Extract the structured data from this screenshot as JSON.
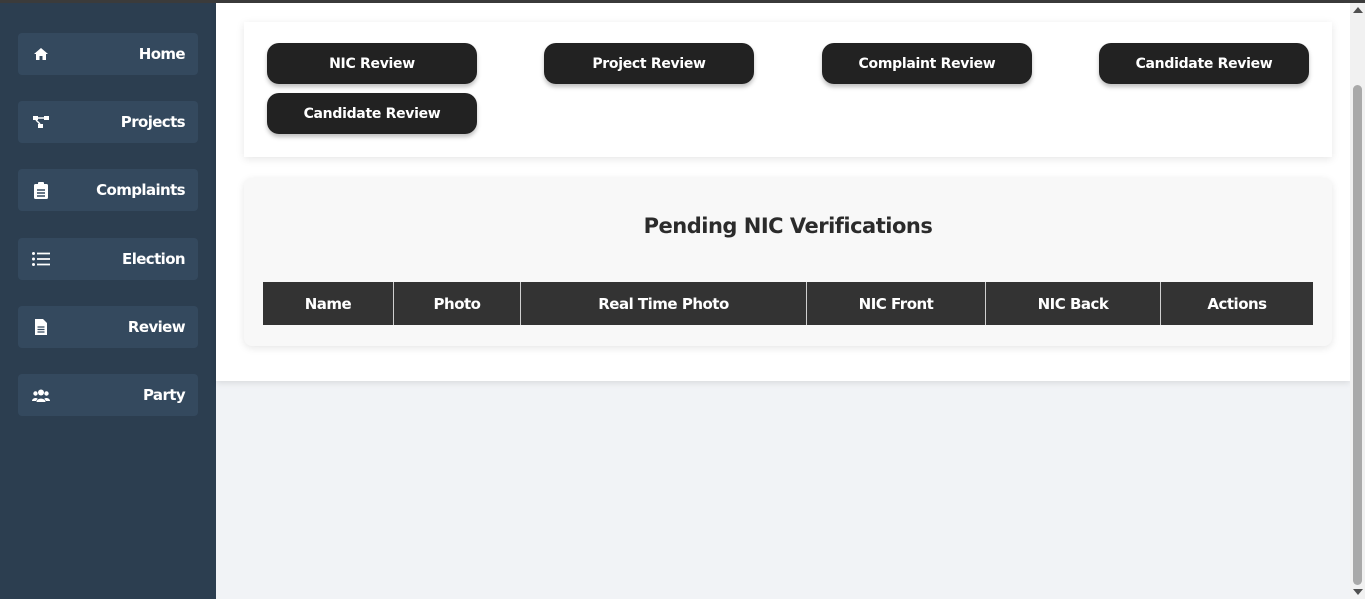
{
  "sidebar": {
    "items": [
      {
        "label": "Home",
        "icon": "home-icon"
      },
      {
        "label": "Projects",
        "icon": "sitemap-icon"
      },
      {
        "label": "Complaints",
        "icon": "clipboard-icon"
      },
      {
        "label": "Election",
        "icon": "list-icon"
      },
      {
        "label": "Review",
        "icon": "file-icon"
      },
      {
        "label": "Party",
        "icon": "users-icon"
      }
    ]
  },
  "tabs": [
    {
      "label": "NIC Review"
    },
    {
      "label": "Project Review"
    },
    {
      "label": "Complaint Review"
    },
    {
      "label": "Candidate Review"
    },
    {
      "label": "Candidate Review"
    }
  ],
  "panel": {
    "title": "Pending NIC Verifications",
    "columns": [
      "Name",
      "Photo",
      "Real Time Photo",
      "NIC Front",
      "NIC Back",
      "Actions"
    ]
  },
  "colors": {
    "sidebar_bg": "#2c3e50",
    "sidebar_item_bg": "#34495e",
    "button_bg": "#222222",
    "table_header_bg": "#333333"
  }
}
